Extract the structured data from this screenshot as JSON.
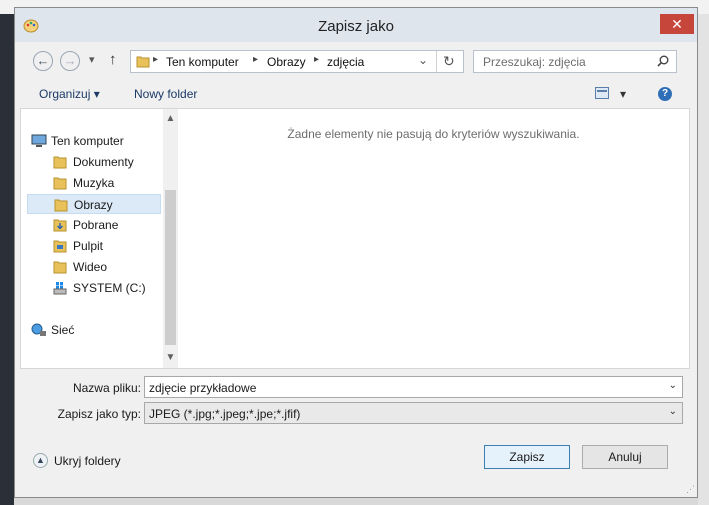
{
  "window": {
    "title": "Zapisz jako",
    "close_glyph": "✕"
  },
  "nav": {
    "back_glyph": "←",
    "forward_glyph": "→",
    "dropdown_glyph": "▾",
    "up_glyph": "↑",
    "breadcrumbs": [
      "Ten komputer",
      "Obrazy",
      "zdjęcia"
    ],
    "separator_glyph": "▸",
    "address_dropdown_glyph": "⌄",
    "refresh_glyph": "↻",
    "search_placeholder": "Przeszukaj: zdjęcia"
  },
  "toolbar": {
    "organize_label": "Organizuj",
    "new_folder_label": "Nowy folder",
    "view_glyph": "▾",
    "help_glyph": "?"
  },
  "tree": {
    "items": [
      {
        "label": "Ten komputer",
        "icon": "computer-icon",
        "level": 0
      },
      {
        "label": "Dokumenty",
        "icon": "folder-icon",
        "level": 1
      },
      {
        "label": "Muzyka",
        "icon": "folder-icon",
        "level": 1
      },
      {
        "label": "Obrazy",
        "icon": "folder-icon",
        "level": 1,
        "selected": true
      },
      {
        "label": "Pobrane",
        "icon": "folder-icon",
        "level": 1
      },
      {
        "label": "Pulpit",
        "icon": "folder-icon",
        "level": 1
      },
      {
        "label": "Wideo",
        "icon": "folder-icon",
        "level": 1
      },
      {
        "label": "SYSTEM (C:)",
        "icon": "drive-icon",
        "level": 1
      },
      {
        "label": "Sieć",
        "icon": "network-icon",
        "level": 0
      }
    ]
  },
  "main": {
    "empty_message": "Żadne elementy nie pasują do kryteriów wyszukiwania."
  },
  "form": {
    "filename_label": "Nazwa pliku:",
    "filename_value": "zdjęcie przykładowe",
    "filetype_label": "Zapisz jako typ:",
    "filetype_value": "JPEG (*.jpg;*.jpeg;*.jpe;*.jfif)"
  },
  "footer": {
    "hide_folders_label": "Ukryj foldery",
    "save_label": "Zapisz",
    "cancel_label": "Anuluj"
  },
  "colors": {
    "accent": "#3c7fb1",
    "selected_bg": "#dceaf7",
    "close_red": "#c7463b"
  }
}
